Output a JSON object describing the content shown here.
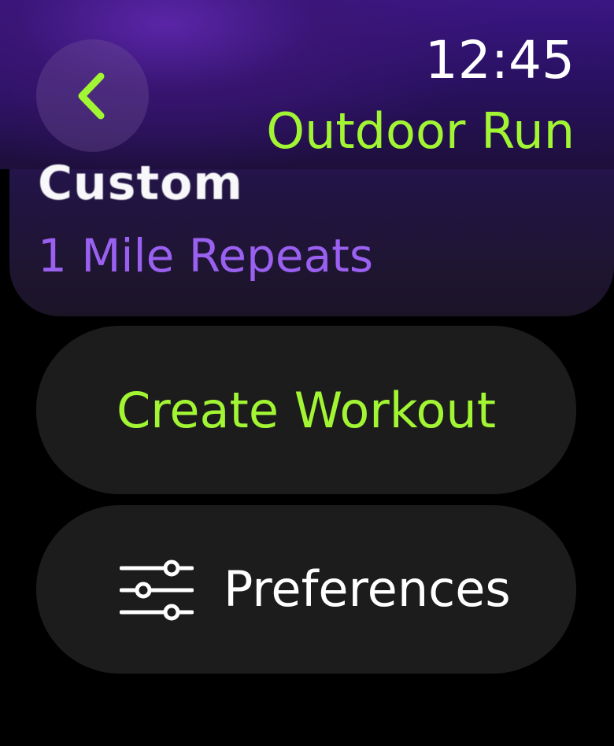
{
  "header": {
    "time": "12:45",
    "title": "Outdoor Run",
    "back_icon": "chevron-left-icon"
  },
  "workout_card": {
    "title": "Custom",
    "subtitle": "1 Mile Repeats"
  },
  "actions": {
    "create_workout_label": "Create Workout",
    "preferences_label": "Preferences",
    "preferences_icon": "sliders-icon"
  },
  "colors": {
    "accent": "#a2f533",
    "subtitle_purple": "#9a60f0",
    "button_bg": "#1c1c1c",
    "background": "#000000",
    "header_purple": "#3a1683"
  }
}
